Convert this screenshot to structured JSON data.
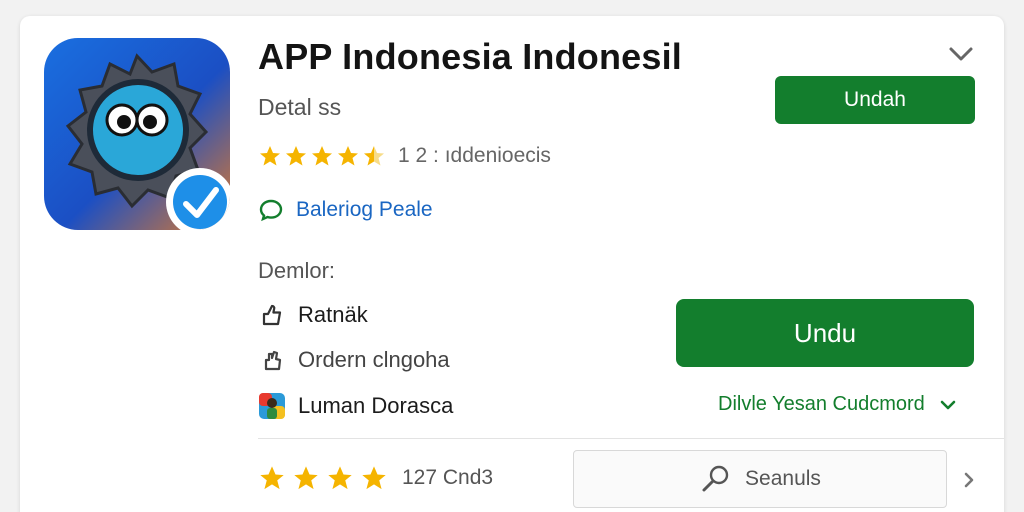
{
  "app": {
    "title": "APP Indonesia Indonesil",
    "subtitle": "Detal ss",
    "install_top_label": "Undah",
    "rating": {
      "stars": 4.5,
      "text": "1 2 : ıddenioecis"
    },
    "link_label": "Baleriog Peale"
  },
  "developer": {
    "header": "Demlor:",
    "items": [
      {
        "icon": "thumbs-up-icon",
        "label": "Ratnäk"
      },
      {
        "icon": "hand-icon",
        "label": "Ordern clngoha"
      },
      {
        "icon": "colorful-avatar-icon",
        "label": "Luman Dorasca"
      }
    ]
  },
  "actions": {
    "install_main_label": "Undu",
    "more_label": "Dilvle Yesan Cudcmord"
  },
  "footer": {
    "rating_stars": 4,
    "rating_count": "127 Cnd3",
    "search_label": "Seanuls"
  },
  "colors": {
    "primary_green": "#137e2d",
    "link_blue": "#1a66c2",
    "star_gold": "#f5b400"
  }
}
